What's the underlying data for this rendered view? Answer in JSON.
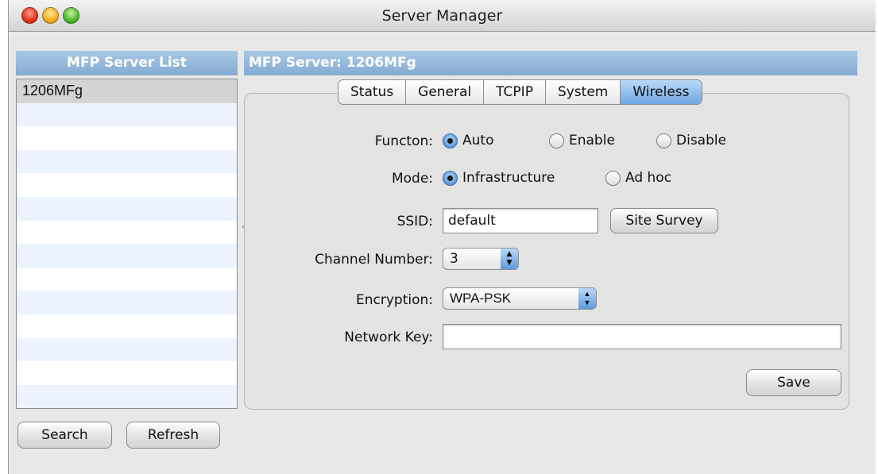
{
  "window": {
    "title": "Server Manager"
  },
  "left": {
    "header": "MFP Server List",
    "servers": [
      "1206MFg"
    ],
    "empty_rows": 13,
    "search_label": "Search",
    "refresh_label": "Refresh"
  },
  "right": {
    "header": "MFP Server: 1206MFg",
    "tabs": [
      "Status",
      "General",
      "TCPIP",
      "System",
      "Wireless"
    ],
    "active_tab": "Wireless",
    "function": {
      "label": "Functon:",
      "options": [
        "Auto",
        "Enable",
        "Disable"
      ],
      "selected": "Auto"
    },
    "mode": {
      "label": "Mode:",
      "options": [
        "Infrastructure",
        "Ad hoc"
      ],
      "selected": "Infrastructure"
    },
    "ssid": {
      "label": "SSID:",
      "value": "default",
      "button": "Site Survey"
    },
    "channel": {
      "label": "Channel Number:",
      "value": "3"
    },
    "encryption": {
      "label": "Encryption:",
      "value": "WPA-PSK"
    },
    "network_key": {
      "label": "Network Key:",
      "value": ""
    },
    "save_label": "Save"
  },
  "colors": {
    "header_blue": "#84abd2",
    "active_tab": "#6fa7e3",
    "selection": "#d4d4d4"
  }
}
